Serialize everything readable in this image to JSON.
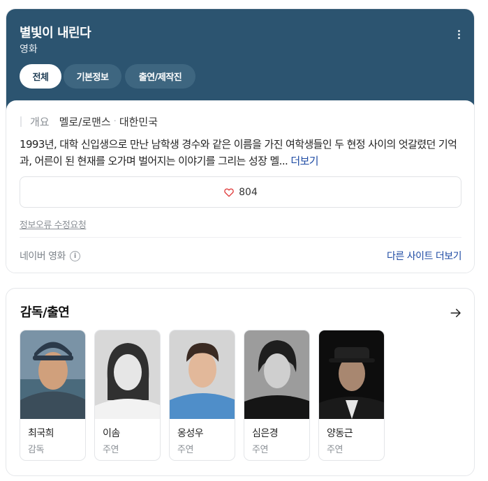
{
  "header": {
    "title": "별빛이 내린다",
    "subtitle": "영화",
    "more_icon": "more-vertical-icon",
    "tabs": [
      {
        "label": "전체",
        "active": true
      },
      {
        "label": "기본정보",
        "active": false
      },
      {
        "label": "출연/제작진",
        "active": false
      }
    ],
    "bg_color": "#2c5470"
  },
  "overview": {
    "label": "개요",
    "genre": "멜로/로맨스",
    "separator": "·",
    "country": "대한민국"
  },
  "description": {
    "text": "1993년, 대학 신입생으로 만난 남학생 경수와 같은 이름을 가진 여학생들인 두 현정 사이의 엇갈렸던 기억과, 어른이 된 현재를 오가며 벌어지는 이야기를 그리는 성장 멜...",
    "more_label": "더보기"
  },
  "likes": {
    "icon": "heart-icon",
    "count": "804"
  },
  "report_label": "정보오류 수정요청",
  "source": {
    "label": "네이버 영화",
    "info_icon": "info-icon",
    "other_sites_label": "다른 사이트 더보기"
  },
  "cast": {
    "title": "감독/출연",
    "arrow_icon": "arrow-right-icon",
    "people": [
      {
        "name": "최국희",
        "role": "감독"
      },
      {
        "name": "이솜",
        "role": "주연"
      },
      {
        "name": "옹성우",
        "role": "주연"
      },
      {
        "name": "심은경",
        "role": "주연"
      },
      {
        "name": "양동근",
        "role": "주연"
      }
    ]
  }
}
